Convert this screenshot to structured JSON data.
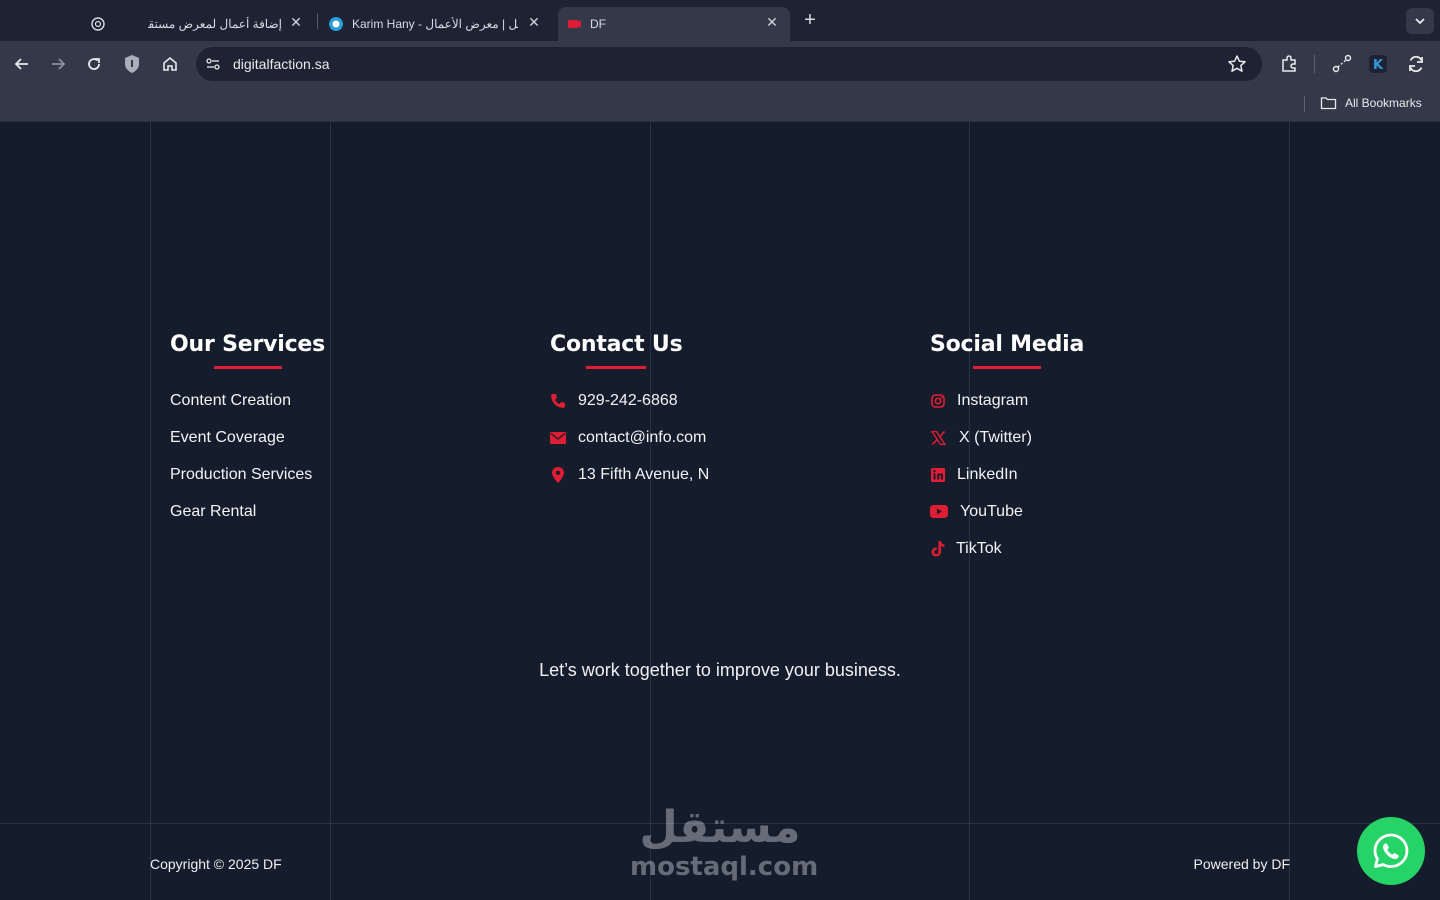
{
  "browser": {
    "tabs": [
      {
        "title": "إضافة أعمال لمعرض مستقل",
        "favicon": "openai-icon"
      },
      {
        "title": "Karim Hany - مستقل | معرض الأعمال",
        "favicon": "mostaql-icon"
      },
      {
        "title": "DF",
        "favicon": "df-icon",
        "active": true
      }
    ],
    "url": "digitalfaction.sa",
    "bookmarks_label": "All Bookmarks"
  },
  "footer": {
    "services": {
      "heading": "Our Services",
      "items": [
        "Content Creation",
        "Event Coverage",
        "Production Services",
        "Gear Rental"
      ]
    },
    "contact": {
      "heading": "Contact Us",
      "items": [
        {
          "icon": "phone-icon",
          "text": "929-242-6868"
        },
        {
          "icon": "envelope-icon",
          "text": "contact@info.com"
        },
        {
          "icon": "location-pin-icon",
          "text": "13 Fifth Avenue, N"
        }
      ]
    },
    "social": {
      "heading": "Social Media",
      "items": [
        {
          "icon": "instagram-icon",
          "text": "Instagram"
        },
        {
          "icon": "x-twitter-icon",
          "text": "X (Twitter)"
        },
        {
          "icon": "linkedin-icon",
          "text": "LinkedIn"
        },
        {
          "icon": "youtube-icon",
          "text": "YouTube"
        },
        {
          "icon": "tiktok-icon",
          "text": "TikTok"
        }
      ]
    },
    "tagline": "Let’s work together to improve your business.",
    "copyright": "Copyright © 2025 DF",
    "powered_by": "Powered by DF"
  },
  "watermark": {
    "arabic": "مستقل",
    "latin": "mostaql.com"
  },
  "colors": {
    "accent": "#e11d33",
    "background": "#151d2c",
    "whatsapp": "#25d366"
  }
}
